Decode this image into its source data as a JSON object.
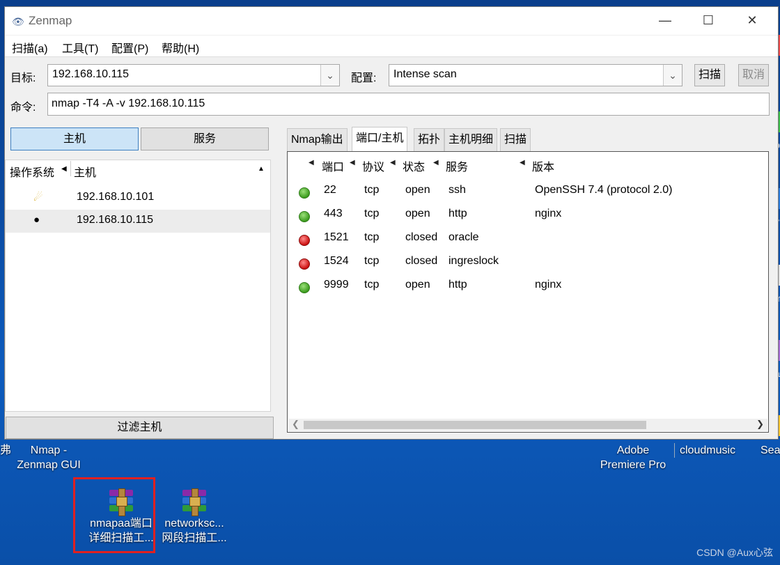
{
  "window": {
    "title": "Zenmap",
    "controls": {
      "minimize": "—",
      "maximize": "☐",
      "close": "✕"
    }
  },
  "menu": [
    "扫描(a)",
    "工具(T)",
    "配置(P)",
    "帮助(H)"
  ],
  "toolbar": {
    "target_label": "目标:",
    "target_value": "192.168.10.115",
    "profile_label": "配置:",
    "profile_value": "Intense scan",
    "scan_button": "扫描",
    "cancel_button": "取消",
    "command_label": "命令:",
    "command_value": "nmap -T4 -A -v 192.168.10.115"
  },
  "left_pane": {
    "hosts_toggle": "主机",
    "services_toggle": "服务",
    "col_os": "操作系统",
    "col_host": "主机",
    "hosts": [
      {
        "ip": "192.168.10.101",
        "os_icon": "unknown-os-icon"
      },
      {
        "ip": "192.168.10.115",
        "os_icon": "linux-penguin-icon",
        "selected": true
      }
    ],
    "filter_button": "过滤主机"
  },
  "tabs": [
    "Nmap输出",
    "端口/主机",
    "拓扑",
    "主机明细",
    "扫描"
  ],
  "active_tab": "端口/主机",
  "ports_table": {
    "headers": [
      "端口",
      "协议",
      "状态",
      "服务",
      "版本"
    ],
    "rows": [
      {
        "port": "22",
        "proto": "tcp",
        "state": "open",
        "service": "ssh",
        "version": "OpenSSH 7.4 (protocol 2.0)"
      },
      {
        "port": "443",
        "proto": "tcp",
        "state": "open",
        "service": "http",
        "version": "nginx"
      },
      {
        "port": "1521",
        "proto": "tcp",
        "state": "closed",
        "service": "oracle",
        "version": ""
      },
      {
        "port": "1524",
        "proto": "tcp",
        "state": "closed",
        "service": "ingreslock",
        "version": ""
      },
      {
        "port": "9999",
        "proto": "tcp",
        "state": "open",
        "service": "http",
        "version": "nginx"
      }
    ]
  },
  "desktop": {
    "nmap_label_1": "Nmap -",
    "nmap_label_2": "Zenmap GUI",
    "adobe_label_1": "Adobe",
    "adobe_label_2": "Premiere Pro",
    "cloudmusic_label": "cloudmusic",
    "sea_label": "Sea",
    "left_fragment": "弗",
    "file1_line1": "nmapaa端口",
    "file1_line2": "详细扫描工...",
    "file2_line1": "networksc...",
    "file2_line2": "网段扫描工...",
    "watermark": "CSDN @Aux心弦",
    "edge_letters": [
      "p",
      "v",
      "m",
      "a"
    ]
  },
  "colors": {
    "open": "#3c9c1e",
    "closed": "#cc1111",
    "accent": "#3c7fc1"
  }
}
